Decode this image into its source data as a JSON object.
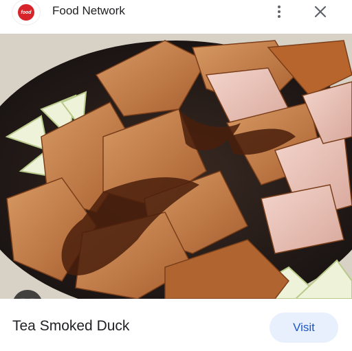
{
  "header": {
    "logo_text": "food",
    "source_name": "Food Network",
    "more_icon": "more-vert-icon",
    "close_icon": "close-icon"
  },
  "image": {
    "lens_icon": "lens-icon"
  },
  "result": {
    "title": "Tea Smoked Duck",
    "visit_label": "Visit"
  },
  "colors": {
    "brand_red": "#d6242a",
    "visit_bg": "#e8f0fe",
    "visit_text": "#1a56c8"
  }
}
